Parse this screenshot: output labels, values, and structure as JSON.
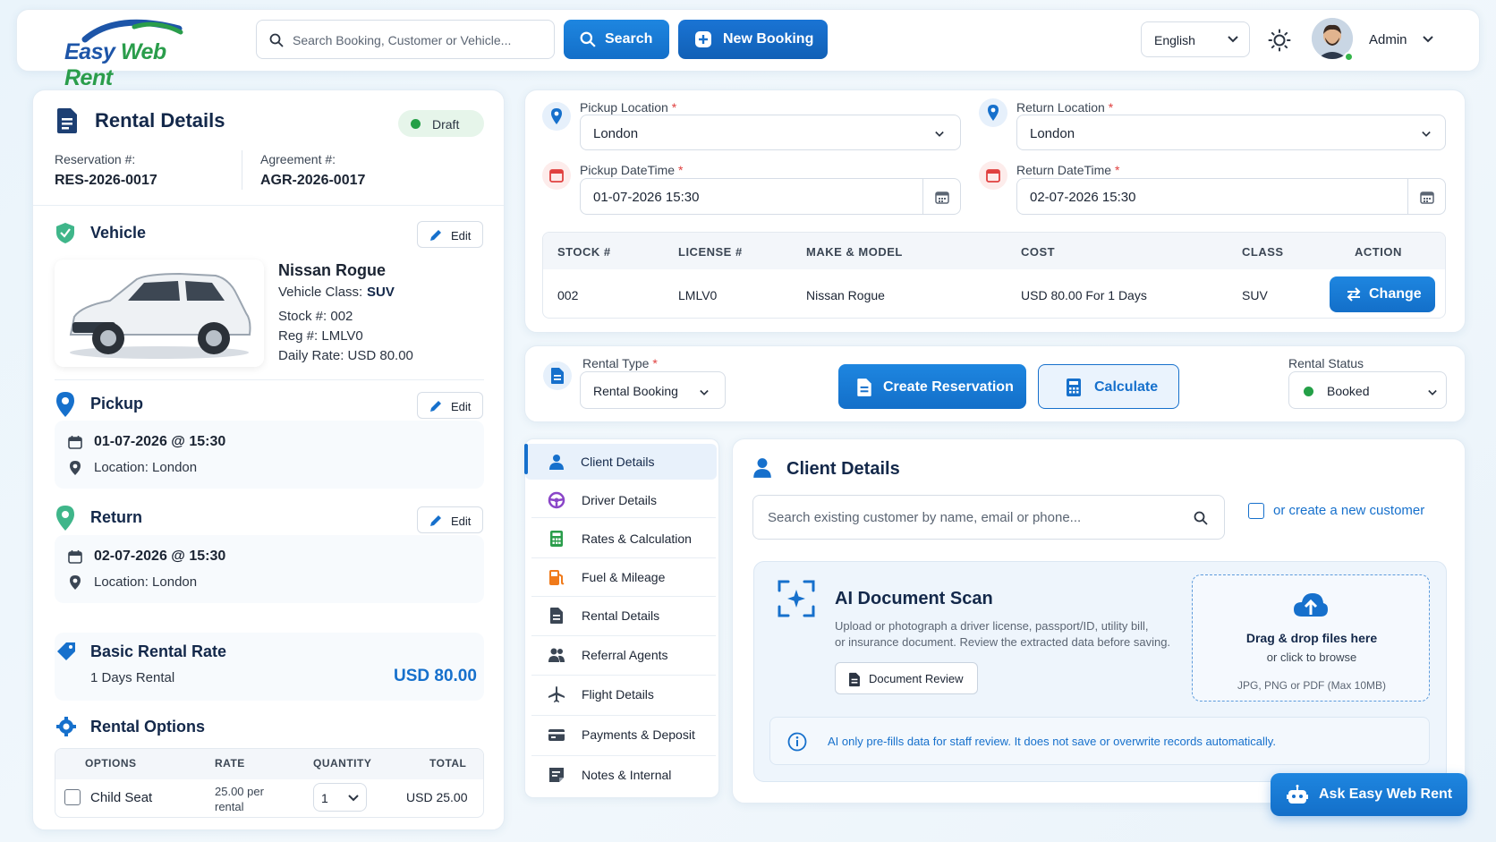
{
  "header": {
    "logo_easy": "Easy",
    "logo_web": "Web",
    "logo_rent": "Rent",
    "search_placeholder": "Search Booking, Customer or Vehicle...",
    "search_button": "Search",
    "new_booking_button": "New Booking",
    "language": "English",
    "user_name": "Admin"
  },
  "rental": {
    "title": "Rental Details",
    "status_badge": "Draft",
    "reservation_label": "Reservation #:",
    "reservation_value": "RES-2026-0017",
    "agreement_label": "Agreement #:",
    "agreement_value": "AGR-2026-0017",
    "vehicle_title": "Vehicle",
    "edit_label": "Edit",
    "vehicle_name": "Nissan Rogue",
    "vehicle_class_label": "Vehicle Class:",
    "vehicle_class_value": "SUV",
    "stock": "Stock #: 002",
    "reg": "Reg #: LMLV0",
    "daily_rate": "Daily Rate: USD 80.00",
    "pickup_title": "Pickup",
    "pickup_datetime": "01-07-2026 @ 15:30",
    "pickup_location": "Location: London",
    "return_title": "Return",
    "return_datetime": "02-07-2026 @ 15:30",
    "return_location": "Location: London",
    "basic_rate_title": "Basic Rental Rate",
    "basic_rate_days": "1 Days Rental",
    "basic_rate_amount": "USD 80.00",
    "options_title": "Rental Options",
    "options_headers": [
      "OPTIONS",
      "RATE",
      "QUANTITY",
      "TOTAL"
    ],
    "option_row": {
      "name": "Child Seat",
      "rate_line1": "25.00 per",
      "rate_line2": "rental",
      "quantity": "1",
      "total": "USD 25.00"
    }
  },
  "booking": {
    "pickup_location_label": "Pickup Location",
    "pickup_location_value": "London",
    "return_location_label": "Return Location",
    "return_location_value": "London",
    "pickup_datetime_label": "Pickup DateTime",
    "pickup_datetime_value": "01-07-2026 15:30",
    "return_datetime_label": "Return DateTime",
    "return_datetime_value": "02-07-2026 15:30",
    "required_mark": "*",
    "table_headers": [
      "STOCK #",
      "LICENSE #",
      "MAKE & MODEL",
      "COST",
      "CLASS",
      "ACTION"
    ],
    "table_row": {
      "stock": "002",
      "license": "LMLV0",
      "model": "Nissan Rogue",
      "cost": "USD 80.00 For 1 Days",
      "class": "SUV",
      "action": "Change"
    }
  },
  "actions": {
    "rental_type_label": "Rental Type",
    "rental_type_value": "Rental Booking",
    "create_reservation": "Create Reservation",
    "calculate": "Calculate",
    "rental_status_label": "Rental Status",
    "rental_status_value": "Booked"
  },
  "sidebar": {
    "items": [
      {
        "label": "Client Details"
      },
      {
        "label": "Driver Details"
      },
      {
        "label": "Rates & Calculation"
      },
      {
        "label": "Fuel & Mileage"
      },
      {
        "label": "Rental Details"
      },
      {
        "label": "Referral Agents"
      },
      {
        "label": "Flight Details"
      },
      {
        "label": "Payments & Deposit"
      },
      {
        "label": "Notes & Internal"
      }
    ]
  },
  "client": {
    "title": "Client Details",
    "search_placeholder": "Search existing customer by name, email or phone...",
    "create_new": "or create a new customer",
    "scan_title": "AI Document Scan",
    "scan_desc_line1": "Upload or photograph a driver license, passport/ID, utility bill,",
    "scan_desc_line2": "or insurance document. Review the extracted data before saving.",
    "document_review": "Document Review",
    "drop_title": "Drag & drop files here",
    "drop_sub": "or click to browse",
    "drop_formats": "JPG, PNG or PDF (Max 10MB)",
    "info_note": "AI only pre-fills data for staff review. It does not save or overwrite records automatically."
  },
  "assistant": {
    "label": "Ask Easy Web Rent"
  },
  "colors": {
    "primary": "#1670cc",
    "accent_green": "#2a9d4b",
    "brand_navy": "#1d55a8"
  }
}
